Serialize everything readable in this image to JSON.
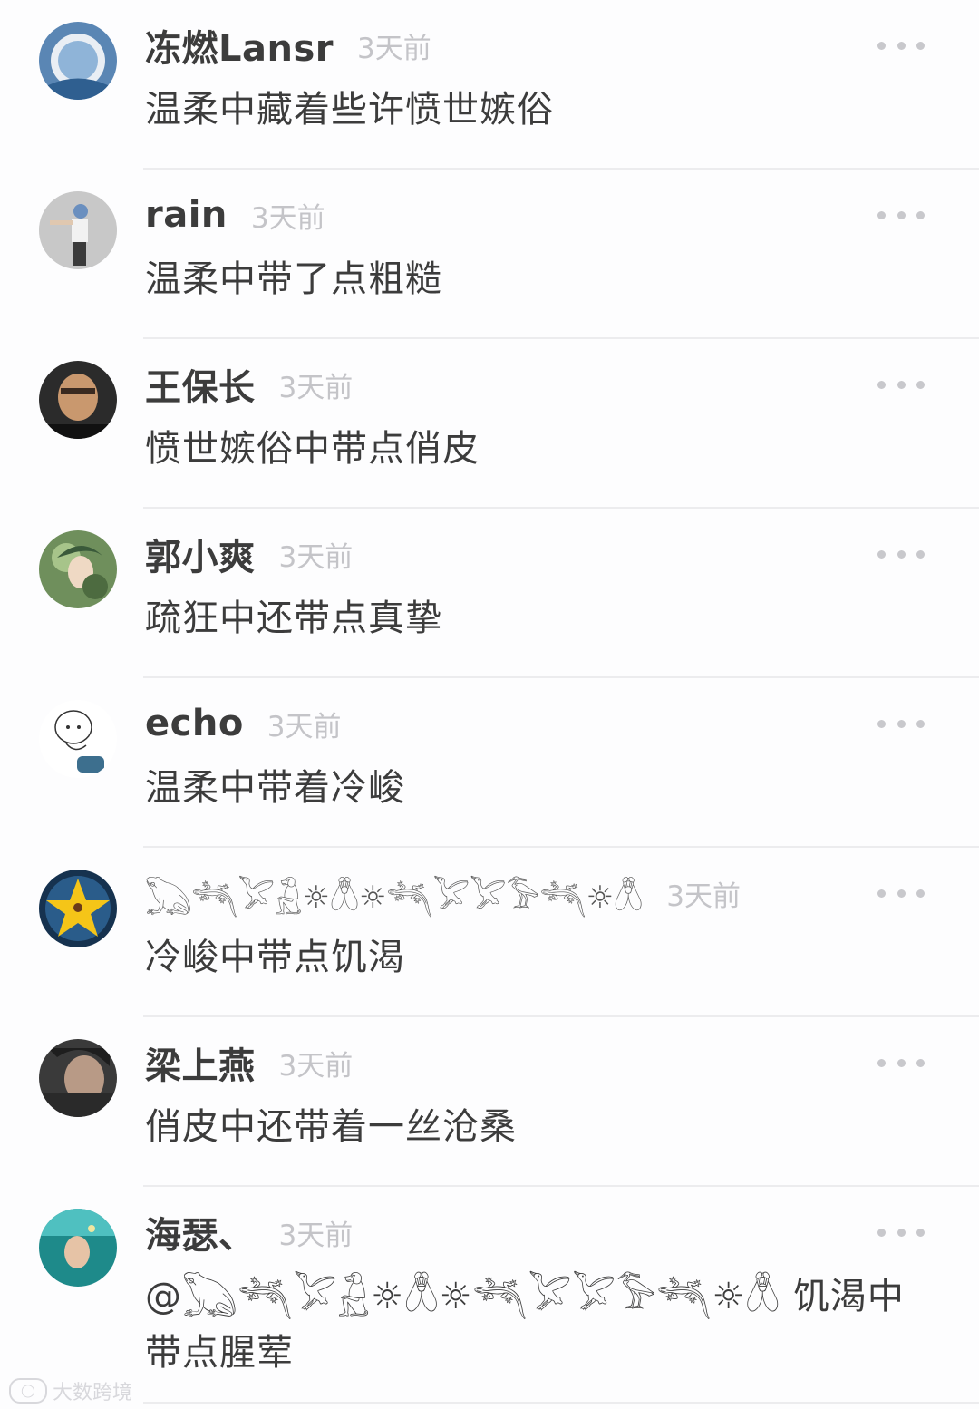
{
  "comments": [
    {
      "name": "冻燃Lansr",
      "time": "3天前",
      "text": "温柔中藏着些许愤世嫉俗",
      "avatar": "avatar-1"
    },
    {
      "name": "rain",
      "time": "3天前",
      "text": "温柔中带了点粗糙",
      "avatar": "avatar-2"
    },
    {
      "name": "王保长",
      "time": "3天前",
      "text": "愤世嫉俗中带点俏皮",
      "avatar": "avatar-3"
    },
    {
      "name": "郭小爽",
      "time": "3天前",
      "text": "疏狂中还带点真挚",
      "avatar": "avatar-4"
    },
    {
      "name": "echo",
      "time": "3天前",
      "text": "温柔中带着冷峻",
      "avatar": "avatar-5"
    },
    {
      "name": "𓆏𓆈𓅯𓃻☼𓆦☼𓆈𓅯𓅯𓅣𓆈☼𓆦",
      "time": "3天前",
      "text": "冷峻中带点饥渴",
      "avatar": "avatar-6"
    },
    {
      "name": "梁上燕",
      "time": "3天前",
      "text": "俏皮中还带着一丝沧桑",
      "avatar": "avatar-7"
    },
    {
      "name": "海瑟、",
      "time": "3天前",
      "text": "@𓆏𓆈𓅯𓃻☼𓆦☼𓆈𓅯𓅯𓅣𓆈☼𓆦 饥渴中带点腥荤",
      "avatar": "avatar-8"
    }
  ],
  "watermark": "大数跨境",
  "colors": {
    "name": "#3c3c3c",
    "time": "#c4c4c8",
    "divider": "#ececee",
    "dots": "#c8c8cc"
  }
}
